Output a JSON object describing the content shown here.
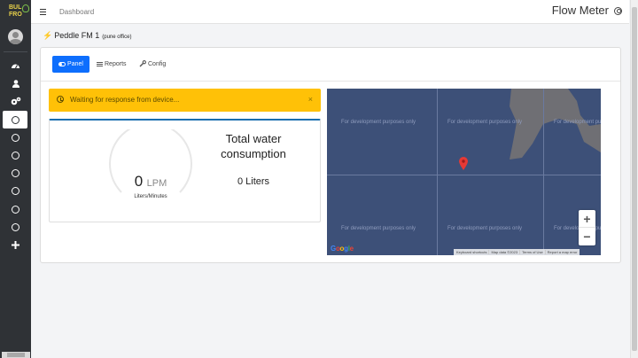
{
  "sidebar": {
    "logo_line1": "BUL",
    "logo_line2": "FRO",
    "items": [
      {
        "icon": "dashboard-icon"
      },
      {
        "icon": "user-icon"
      },
      {
        "icon": "gears-icon"
      },
      {
        "icon": "circle-icon",
        "active": true
      },
      {
        "icon": "circle-icon"
      },
      {
        "icon": "circle-icon"
      },
      {
        "icon": "circle-icon"
      },
      {
        "icon": "circle-icon"
      },
      {
        "icon": "circle-icon"
      },
      {
        "icon": "circle-icon"
      },
      {
        "icon": "plus-icon"
      }
    ]
  },
  "header": {
    "breadcrumb": "Dashboard",
    "title": "Flow Meter"
  },
  "device": {
    "name": "Peddle FM 1",
    "office": "(pune office)"
  },
  "tabs": [
    {
      "label": "Panel",
      "active": true
    },
    {
      "label": "Reports"
    },
    {
      "label": "Config"
    }
  ],
  "alert": {
    "text": "Waiting for response from device...",
    "close": "×",
    "color": "#ffc107"
  },
  "flow": {
    "value": "0",
    "unit": "LPM",
    "sublabel": "Liters/Minutes",
    "total_title": "Total water consumption",
    "total_value": "0 Liters"
  },
  "map": {
    "watermark": "For development purposes only",
    "google": "Google",
    "footer": [
      "Keyboard shortcuts",
      "Map data ©2023",
      "Terms of Use",
      "Report a map error"
    ],
    "zoom_in": "+",
    "zoom_out": "−"
  },
  "colors": {
    "primary": "#0d6efd",
    "sidebar": "#2f3236",
    "map_water": "#3d5078",
    "pin": "#e53935"
  }
}
